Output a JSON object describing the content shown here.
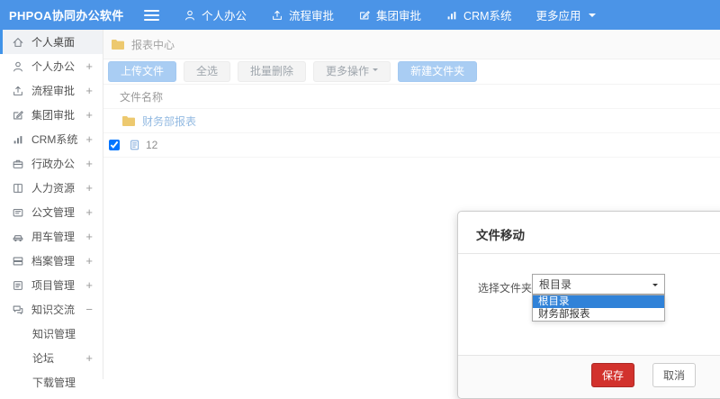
{
  "navbar": {
    "logo": "PHPOA协同办公软件",
    "items": [
      {
        "label": "个人办公",
        "icon": "user-icon"
      },
      {
        "label": "流程审批",
        "icon": "approve-icon"
      },
      {
        "label": "集团审批",
        "icon": "edit-icon"
      },
      {
        "label": "CRM系统",
        "icon": "chart-icon"
      },
      {
        "label": "更多应用",
        "icon": "chevron-down-icon"
      }
    ]
  },
  "sidebar": {
    "items": [
      {
        "label": "个人桌面",
        "icon": "home-icon",
        "active": true,
        "expand": ""
      },
      {
        "label": "个人办公",
        "icon": "user-icon",
        "expand": "+"
      },
      {
        "label": "流程审批",
        "icon": "approve-icon",
        "expand": "+"
      },
      {
        "label": "集团审批",
        "icon": "edit-icon",
        "expand": "+"
      },
      {
        "label": "CRM系统",
        "icon": "chart-icon",
        "expand": "+"
      },
      {
        "label": "行政办公",
        "icon": "briefcase-icon",
        "expand": "+"
      },
      {
        "label": "人力资源",
        "icon": "book-icon",
        "expand": "+"
      },
      {
        "label": "公文管理",
        "icon": "doc-icon",
        "expand": "+"
      },
      {
        "label": "用车管理",
        "icon": "car-icon",
        "expand": "+"
      },
      {
        "label": "档案管理",
        "icon": "archive-icon",
        "expand": "+"
      },
      {
        "label": "项目管理",
        "icon": "project-icon",
        "expand": "+"
      },
      {
        "label": "知识交流",
        "icon": "chat-icon",
        "expand": "−"
      },
      {
        "label": "知识管理",
        "sub": true,
        "expand": ""
      },
      {
        "label": "论坛",
        "sub": true,
        "expand": "+"
      },
      {
        "label": "下载管理",
        "sub": true,
        "expand": ""
      }
    ]
  },
  "breadcrumb": {
    "label": "报表中心",
    "icon": "folder-icon"
  },
  "toolbar": {
    "upload_label": "上传文件",
    "select_all_label": "全选",
    "batch_delete_label": "批量删除",
    "more_actions_label": "更多操作",
    "new_folder_label": "新建文件夹"
  },
  "file_table": {
    "columns": [
      "文件名称"
    ],
    "rows": [
      {
        "name": "财务部报表",
        "type": "folder",
        "checked": false
      },
      {
        "name": "12",
        "type": "file",
        "checked": true
      }
    ]
  },
  "modal": {
    "title": "文件移动",
    "field_label": "选择文件夹",
    "select_value": "根目录",
    "options": [
      {
        "label": "根目录",
        "selected": true
      },
      {
        "label": "财务部报表",
        "selected": false
      }
    ],
    "save_label": "保存",
    "cancel_label": "取消"
  },
  "colors": {
    "navbar_blue": "#4b94e7",
    "active_border_blue": "#4193e8",
    "primary_button_blue": "#a9cdf3",
    "option_highlight_blue": "#3082d8",
    "save_button_red": "#d2322d",
    "folder_yellow": "#edc96f",
    "link_blue": "#93bae2"
  }
}
